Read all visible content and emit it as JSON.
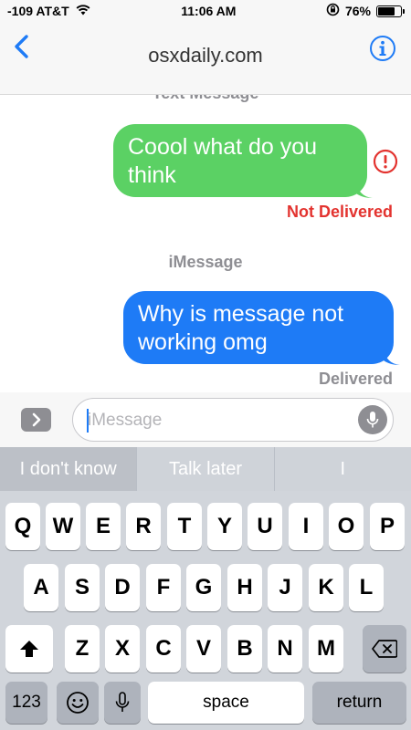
{
  "status_bar": {
    "carrier": "-109 AT&T",
    "time": "11:06 AM",
    "battery_percent": "76%",
    "battery_level": 0.76,
    "icons": [
      "wifi-icon",
      "orientation-lock-icon",
      "battery-icon"
    ]
  },
  "nav": {
    "title": "osxdaily.com",
    "back_icon": "chevron-left-icon",
    "info_icon": "info-icon",
    "accent_color": "#1e7bf6"
  },
  "messages": {
    "service_top": "Text Message",
    "green_message": "Coool what do you think",
    "green_status": "Not Delivered",
    "service_mid": "iMessage",
    "blue_message": "Why is message not working omg",
    "blue_status": "Delivered",
    "colors": {
      "sms_bubble": "#5bd164",
      "imessage_bubble": "#1e7bf6",
      "error": "#e3332f"
    }
  },
  "input": {
    "placeholder": "iMessage",
    "apps_icon": "chevron-right-icon",
    "mic_icon": "microphone-icon"
  },
  "predictive": [
    "I don't know",
    "Talk later",
    "I"
  ],
  "keyboard": {
    "row1": [
      "Q",
      "W",
      "E",
      "R",
      "T",
      "Y",
      "U",
      "I",
      "O",
      "P"
    ],
    "row2": [
      "A",
      "S",
      "D",
      "F",
      "G",
      "H",
      "J",
      "K",
      "L"
    ],
    "row3": [
      "Z",
      "X",
      "C",
      "V",
      "B",
      "N",
      "M"
    ],
    "numbers_label": "123",
    "space_label": "space",
    "return_label": "return",
    "shift_icon": "shift-icon",
    "delete_icon": "delete-icon",
    "emoji_icon": "emoji-icon",
    "dictation_icon": "microphone-icon"
  }
}
